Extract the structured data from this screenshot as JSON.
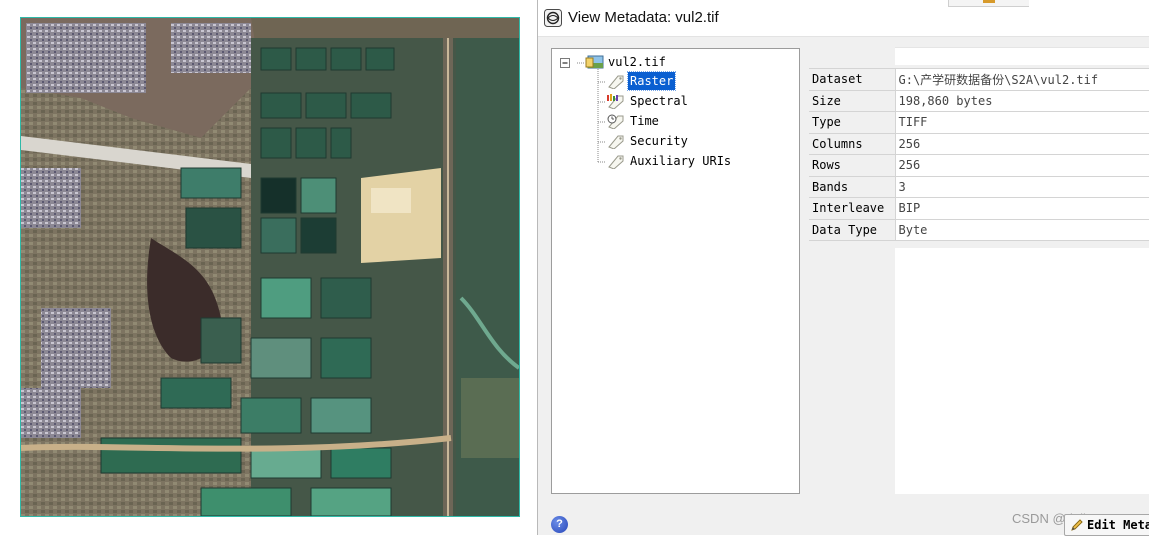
{
  "satellite_image": {
    "description_icon": "satellite-raster-image"
  },
  "window": {
    "title": "View Metadata: vul2.tif",
    "icon": "envi-globe-icon"
  },
  "tree": {
    "root": {
      "label": "vul2.tif",
      "expander": "⊟",
      "icon": "raster-file-icon"
    },
    "items": [
      {
        "label": "Raster",
        "icon": "tag-icon",
        "selected": true
      },
      {
        "label": "Spectral",
        "icon": "spectral-tag-icon",
        "selected": false
      },
      {
        "label": "Time",
        "icon": "time-tag-icon",
        "selected": false
      },
      {
        "label": "Security",
        "icon": "tag-icon",
        "selected": false
      },
      {
        "label": "Auxiliary URIs",
        "icon": "tag-icon",
        "selected": false
      }
    ]
  },
  "properties": [
    {
      "key": "Dataset",
      "value": "G:\\产学研数据备份\\S2A\\vul2.tif"
    },
    {
      "key": "Size",
      "value": "198,860 bytes"
    },
    {
      "key": "Type",
      "value": "TIFF"
    },
    {
      "key": "Columns",
      "value": "256"
    },
    {
      "key": "Rows",
      "value": "256"
    },
    {
      "key": "Bands",
      "value": "3"
    },
    {
      "key": "Interleave",
      "value": "BIP"
    },
    {
      "key": "Data Type",
      "value": "Byte"
    }
  ],
  "footer": {
    "help_label": "?",
    "watermark": "CSDN @doll ~CJ",
    "edit_button_label": "Edit Metadata"
  },
  "colors": {
    "selection": "#0a5fd1",
    "frame": "#2fb9a8"
  }
}
